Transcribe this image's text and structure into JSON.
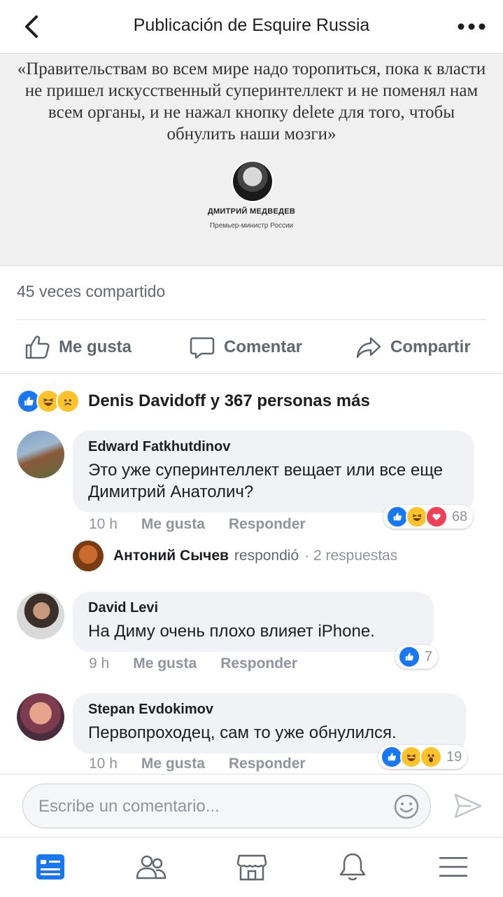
{
  "header": {
    "title": "Publicación de Esquire Russia",
    "back_icon": "chevron-left-icon",
    "more_icon": "more-horizontal-icon"
  },
  "quote": {
    "text": "«Правительствам во всем мире надо торопиться, пока к власти не пришел искусственный суперинтеллект и не поменял нам всем органы, и не нажал кнопку delete для того, чтобы обнулить наши мозги»",
    "author": "ДМИТРИЙ МЕДВЕДЕВ",
    "role": "Премьер-министр России"
  },
  "shares": "45 veces compartido",
  "actions": {
    "like": "Me gusta",
    "comment": "Comentar",
    "share": "Compartir"
  },
  "reactions_summary": "Denis  Davidoff y 367 personas más",
  "comments": [
    {
      "name": "Edward Fatkhutdinov",
      "text": "Это уже суперинтеллект вещает или все еще Димитрий Анатолич?",
      "time": "10 h",
      "like": "Me gusta",
      "reply": "Responder",
      "reaction_count": "68"
    },
    {
      "name": "David Levi",
      "text": "На Диму очень плохо влияет iPhone.",
      "time": "9 h",
      "like": "Me gusta",
      "reply": "Responder",
      "reaction_count": "7"
    },
    {
      "name": "Stepan Evdokimov",
      "text": "Первопроходец, сам то уже обнулился.",
      "time": "10 h",
      "like": "Me gusta",
      "reply": "Responder",
      "reaction_count": "19"
    }
  ],
  "reply_preview": {
    "name": "Антоний Сычев",
    "action": "respondió",
    "count": "· 2 respuestas"
  },
  "composer": {
    "placeholder": "Escribe un comentario..."
  },
  "colors": {
    "like_blue": "#1877f2",
    "love_red": "#f33e58",
    "haha_yellow": "#fcc32b",
    "active_tab": "#1877f2",
    "icon_gray": "#606770"
  },
  "tabs": [
    "news-feed-icon",
    "friends-icon",
    "marketplace-icon",
    "notifications-icon",
    "menu-icon"
  ]
}
